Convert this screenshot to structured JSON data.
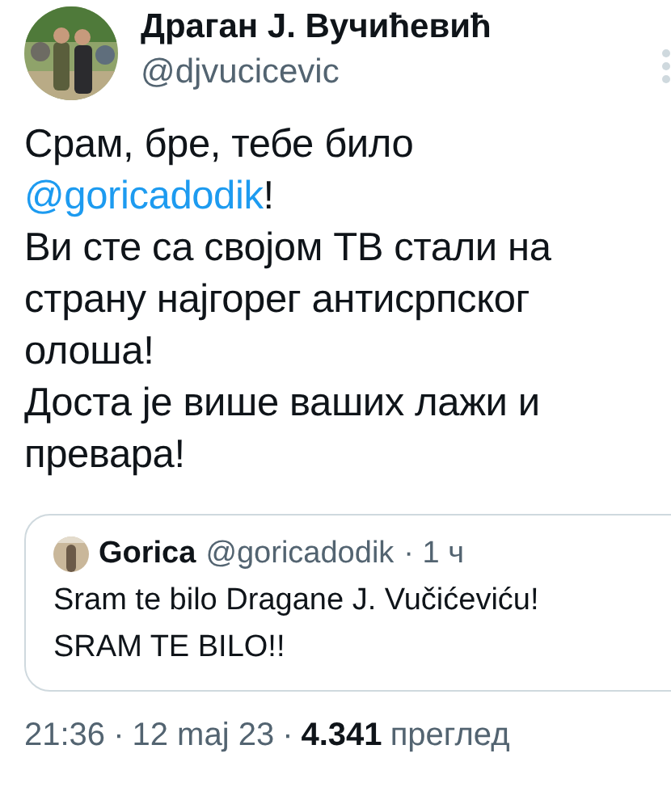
{
  "author": {
    "name": "Драган J. Вучићевић",
    "handle": "@djvucicevic"
  },
  "tweet": {
    "paragraphs": [
      {
        "text": "Срам, бре, тебе било ",
        "mention": "@goricadodik",
        "after": "!"
      },
      {
        "text": "Ви сте са својом ТВ стали на страну најгорег антисрпског олоша!"
      },
      {
        "text": "Доста је више ваших лажи и превара!"
      }
    ]
  },
  "quote": {
    "name": "Gorica",
    "handle": "@goricadodik",
    "time": "· 1 ч",
    "lines": [
      "Sram te bilo Dragane J. Vučićeviću!",
      "SRAM TE BILO!!"
    ]
  },
  "footer": {
    "time": "21:36",
    "separators": [
      "·",
      "·"
    ],
    "date": "12 maj 23",
    "views": "4.341",
    "views_label": "преглед"
  }
}
